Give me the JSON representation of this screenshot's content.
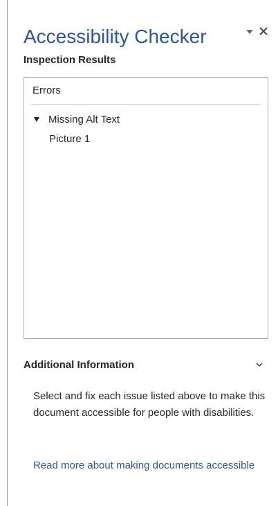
{
  "pane": {
    "title": "Accessibility Checker",
    "menu_icon": "dropdown-triangle-icon",
    "close_icon": "close-icon",
    "accent_color": "#2b579a"
  },
  "inspection": {
    "heading": "Inspection Results",
    "section_header": "Errors",
    "groups": [
      {
        "label": "Missing Alt Text",
        "expanded": true,
        "items": [
          "Picture 1"
        ]
      }
    ]
  },
  "additional_info": {
    "heading": "Additional Information",
    "chevron_icon": "chevron-down-icon",
    "body": "Select and fix each issue listed above to make this document accessible for people with disabilities.",
    "link_text": "Read more about making documents accessible"
  }
}
